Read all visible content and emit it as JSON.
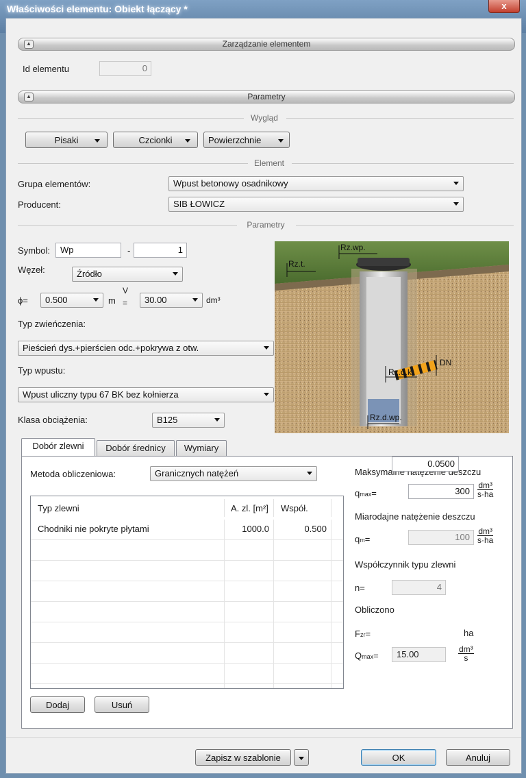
{
  "window": {
    "title": "Właściwości elementu: Obiekt łączący *",
    "close_glyph": "x"
  },
  "sections": {
    "management": "Zarządzanie elementem",
    "parameters": "Parametry"
  },
  "element_id": {
    "label": "Id elementu",
    "value": "0"
  },
  "appearance": {
    "header": "Wygląd",
    "pens": "Pisaki",
    "fonts": "Czcionki",
    "surfaces": "Powierzchnie"
  },
  "element": {
    "header": "Element",
    "group_label": "Grupa elementów:",
    "group_value": "Wpust betonowy osadnikowy",
    "producer_label": "Producent:",
    "producer_value": "SIB ŁOWICZ"
  },
  "params": {
    "header": "Parametry",
    "symbol_label": "Symbol:",
    "symbol_value": "Wp",
    "symbol_dash": "-",
    "symbol_number": "1",
    "node_label": "Węzeł:",
    "node_value": "Źródło",
    "phi_label": "ϕ=",
    "phi_value": "0.500",
    "phi_unit": "m",
    "v_label_top": "V",
    "v_label_bottom": "=",
    "v_value": "30.00",
    "v_unit": "dm³",
    "cap_type_label": "Typ zwieńczenia:",
    "cap_type_value": "Pieścień dys.+pierścien odc.+pokrywa z otw.",
    "inlet_type_label": "Typ wpustu:",
    "inlet_type_value": "Wpust uliczny typu 67 BK bez kołnierza",
    "load_class_label": "Klasa obciążenia:",
    "load_class_value": "B125"
  },
  "diagram": {
    "rz_t": "Rz.t.",
    "rz_wp": "Rz.wp.",
    "dn": "DN",
    "rz_dk": "Rz.d.k.",
    "rz_dwp": "Rz.d.wp."
  },
  "tabs": [
    {
      "label": "Dobór zlewni"
    },
    {
      "label": "Dobór średnicy"
    },
    {
      "label": "Wymiary"
    }
  ],
  "catchment": {
    "method_label": "Metoda obliczeniowa:",
    "method_value": "Granicznych natężeń",
    "columns": [
      "Typ zlewni",
      "A. zl. [m²]",
      "Współ."
    ],
    "rows": [
      {
        "type": "Chodniki nie pokryte płytami",
        "area": "1000.0",
        "coef": "0.500"
      }
    ],
    "add_button": "Dodaj",
    "remove_button": "Usuń"
  },
  "rain": {
    "max_title": "Maksymalne natężenie deszczu",
    "qmax_label": "q",
    "qmax_sub": "max",
    "qmax_eq": "=",
    "qmax_value": "300",
    "unit_num": "dm³",
    "unit_den": "s·ha",
    "design_title": "Miarodajne natężenie deszczu",
    "qm_label": "q",
    "qm_sub": "m",
    "qm_eq": "=",
    "qm_value": "100",
    "coef_title": "Współczynnik typu zlewni",
    "n_label": "n=",
    "n_value": "4",
    "computed_title": "Obliczono",
    "fzr_label": "F",
    "fzr_sub": "zr",
    "fzr_eq": "=",
    "fzr_value": "0.0500",
    "fzr_unit": "ha",
    "Qmax_label": "Q",
    "Qmax_sub": "max",
    "Qmax_eq": "=",
    "Qmax_value": "15.00",
    "Qmax_unit_num": "dm³",
    "Qmax_unit_den": "s"
  },
  "footer": {
    "save_template": "Zapisz w szablonie",
    "ok": "OK",
    "cancel": "Anuluj"
  }
}
